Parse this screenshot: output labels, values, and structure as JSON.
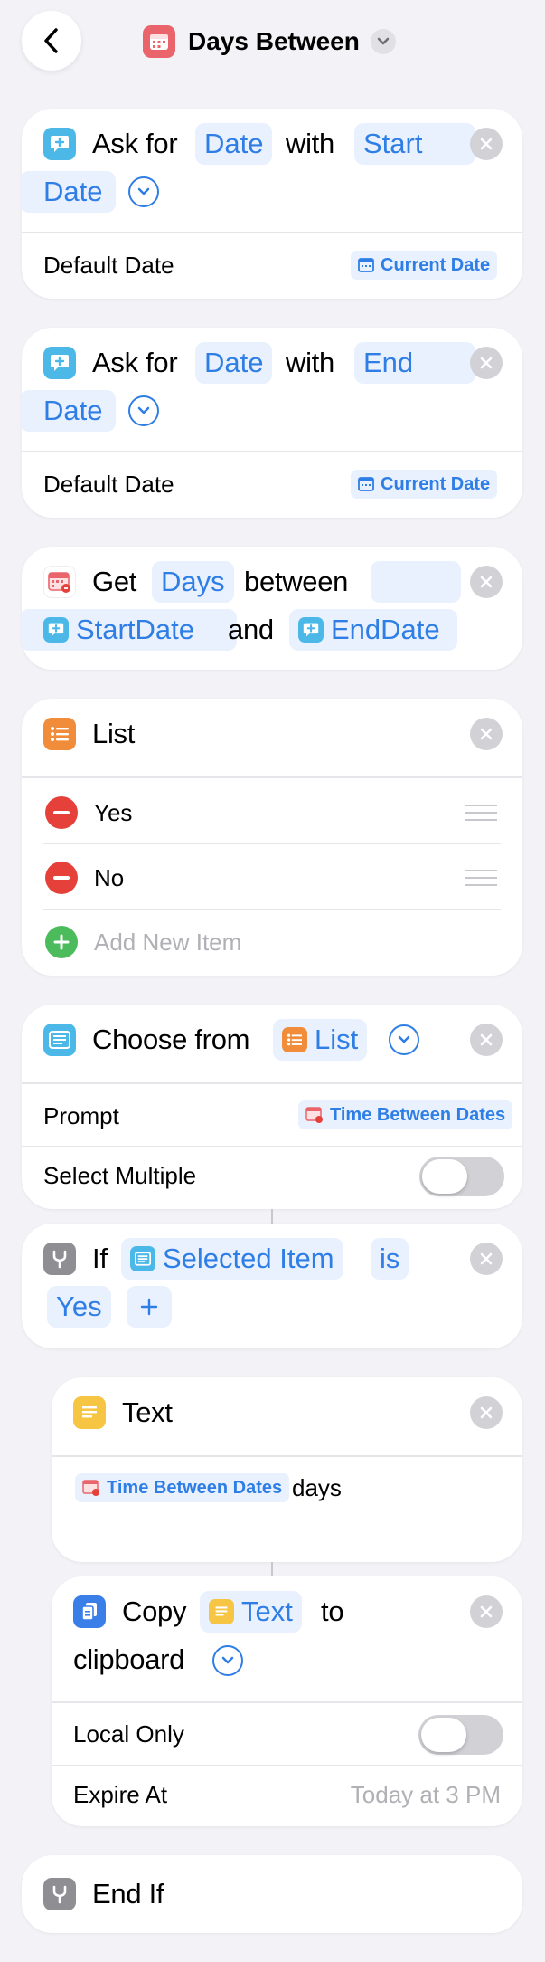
{
  "header": {
    "title": "Days Between",
    "back_icon": "chevron-left-icon",
    "app_icon": "calendar-icon",
    "dropdown_icon": "chevron-down-icon"
  },
  "colors": {
    "accent": "#2f7ee6",
    "token_bg": "#e8f1fd",
    "ask_icon": "#4bb8e8",
    "date_icon": "#e9656b",
    "list_icon": "#f08c3a",
    "if_icon": "#8e8e93",
    "text_icon": "#f5c543",
    "copy_icon": "#3a7fe8"
  },
  "ask1": {
    "ask_for": "Ask for",
    "type": "Date",
    "with": "with",
    "question_part1": "Start",
    "question_part2": "Date",
    "default_label": "Default Date",
    "default_value": "Current Date"
  },
  "ask2": {
    "ask_for": "Ask for",
    "type": "Date",
    "with": "with",
    "question_part1": "End",
    "question_part2": "Date",
    "default_label": "Default Date",
    "default_value": "Current Date"
  },
  "get_days": {
    "get": "Get",
    "unit": "Days",
    "between": "between",
    "start": "StartDate",
    "and": "and",
    "end": "EndDate"
  },
  "list": {
    "title": "List",
    "items": [
      {
        "label": "Yes"
      },
      {
        "label": "No"
      }
    ],
    "add_placeholder": "Add New Item"
  },
  "choose": {
    "choose_from": "Choose from",
    "list_token": "List",
    "prompt_label": "Prompt",
    "prompt_value": "Time Between Dates",
    "select_multiple_label": "Select Multiple"
  },
  "if_block": {
    "if": "If",
    "variable": "Selected Item",
    "condition": "is",
    "value": "Yes"
  },
  "text_block": {
    "title": "Text",
    "variable": "Time Between Dates",
    "suffix": "days"
  },
  "copy_block": {
    "copy": "Copy",
    "text_token": "Text",
    "to": "to",
    "clipboard": "clipboard",
    "local_only_label": "Local Only",
    "expire_label": "Expire At",
    "expire_value": "Today at 3 PM"
  },
  "end_if": {
    "label": "End If"
  }
}
